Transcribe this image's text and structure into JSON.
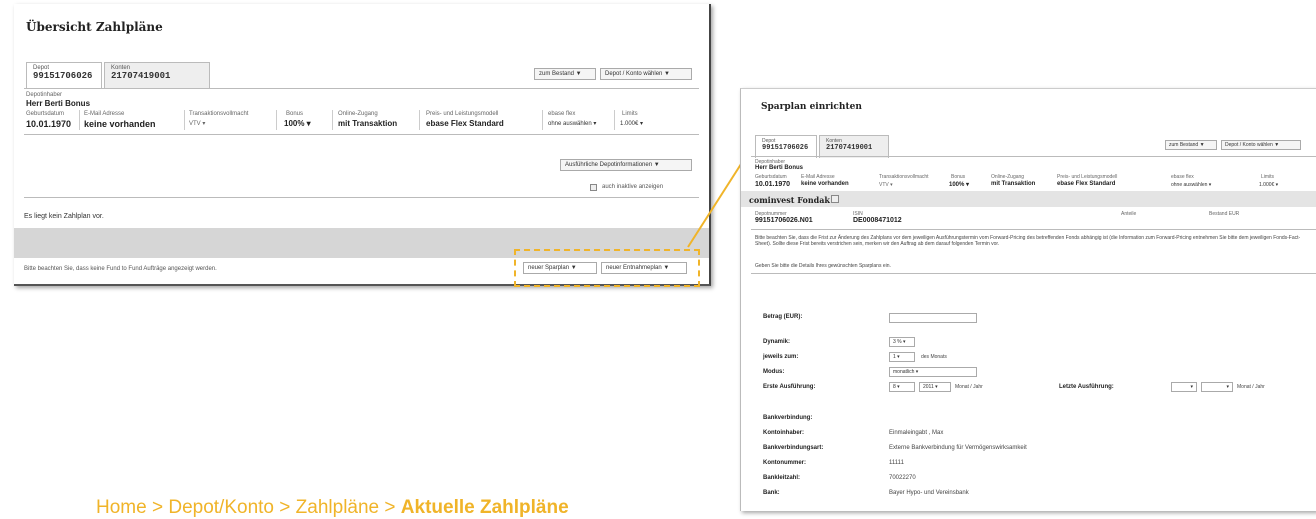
{
  "colors": {
    "accent": "#f0b429",
    "band": "#d6d6d6"
  },
  "left": {
    "title": "Übersicht Zahlpläne",
    "tabs": [
      {
        "label": "Depot",
        "value": "99151706026"
      },
      {
        "label": "Konten",
        "value": "21707419001"
      }
    ],
    "filter1": "zum Bestand ▼",
    "filter2": "Depot / Konto wählen ▼",
    "holder_label": "Depotinhaber",
    "holder_name": "Herr Berti Bonus",
    "fields": [
      {
        "label": "Geburtsdatum",
        "value": "10.01.1970"
      },
      {
        "label": "E-Mail Adresse",
        "value": "keine vorhanden"
      },
      {
        "label": "Transaktionsvollmacht",
        "value": "VTV ▾"
      },
      {
        "label": "Bonus",
        "value": "100% ▾"
      },
      {
        "label": "Online-Zugang",
        "value": "mit Transaktion"
      },
      {
        "label": "Preis- und Leistungsmodell",
        "value": "ebase Flex Standard"
      },
      {
        "label": "ebase flex",
        "value": "ohne auswählen ▾"
      },
      {
        "label": "Limits",
        "value": "1.000€ ▾"
      }
    ],
    "details_button": "Ausführliche Depotinformationen ▼",
    "inactive_label": "auch inaktive anzeigen",
    "no_plans": "Es liegt kein Zahlplan vor.",
    "btn_spar": "neuer Sparplan ▼",
    "btn_entnahme": "neuer Entnahmeplan ▼",
    "note": "Bitte beachten Sie, dass keine Fund to Fund Aufträge angezeigt werden."
  },
  "right": {
    "title": "Sparplan einrichten",
    "tabs": [
      {
        "label": "Depot",
        "value": "99151706026"
      },
      {
        "label": "Konten",
        "value": "21707419001"
      }
    ],
    "filter1": "zum Bestand ▼",
    "filter2": "Depot / Konto wählen ▼",
    "holder_label": "Depotinhaber",
    "holder_name": "Herr Berti Bonus",
    "fields": [
      {
        "label": "Geburtsdatum",
        "value": "10.01.1970"
      },
      {
        "label": "E-Mail Adresse",
        "value": "keine vorhanden"
      },
      {
        "label": "Transaktionsvollmacht",
        "value": "VTV ▾"
      },
      {
        "label": "Bonus",
        "value": "100% ▾"
      },
      {
        "label": "Online-Zugang",
        "value": "mit Transaktion"
      },
      {
        "label": "Preis- und Leistungsmodell",
        "value": "ebase Flex Standard"
      },
      {
        "label": "ebase flex",
        "value": "ohne auswählen ▾"
      },
      {
        "label": "Limits",
        "value": "1.000€ ▾"
      }
    ],
    "fund_name": "cominvest Fondak P",
    "fund_cols": [
      {
        "label": "Depotnummer",
        "value": "99151706026.N01"
      },
      {
        "label": "ISIN",
        "value": "DE0008471012"
      },
      {
        "label": "Anteile",
        "value": ""
      },
      {
        "label": "Bestand EUR",
        "value": ""
      }
    ],
    "info1": "Bitte beachten Sie, dass die Frist zur Änderung des Zahlplans vor dem jeweiligen Ausführungstermin vom Forward-Pricing des betreffenden Fonds abhängig ist (die Information zum Forward-Pricing entnehmen Sie bitte dem jeweiligen Fonds-Fact-Sheet). Sollte diese Frist bereits verstrichen sein, merken wir den Auftrag ab dem darauf folgenden Termin vor.",
    "info2": "Geben Sie bitte die Details Ihres gewünschten Sparplans ein.",
    "form": {
      "betrag_label": "Betrag (EUR):",
      "dynamik_label": "Dynamik:",
      "dynamik_value": "3 % ▾",
      "jeweils_label": "jeweils zum:",
      "jeweils_value": "1 ▾",
      "jeweils_suffix": "des Monats",
      "modus_label": "Modus:",
      "modus_value": "monatlich ▾",
      "erste_label": "Erste Ausführung:",
      "erste_month": "8 ▾",
      "erste_year": "2011 ▾",
      "erste_suffix": "Monat / Jahr",
      "letzte_label": "Letzte Ausführung:",
      "letzte_month": "▾",
      "letzte_year": "▾",
      "letzte_suffix": "Monat / Jahr"
    },
    "bank": {
      "heading": "Bankverbindung:",
      "rows": [
        {
          "label": "Kontoinhaber:",
          "value": "Einmaleingabt , Max"
        },
        {
          "label": "Bankverbindungsart:",
          "value": "Externe Bankverbindung für Vermögenswirksamkeit"
        },
        {
          "label": "Kontonummer:",
          "value": "11111"
        },
        {
          "label": "Bankleitzahl:",
          "value": "70022270"
        },
        {
          "label": "Bank:",
          "value": "Bayer Hypo- und Vereinsbank"
        }
      ]
    }
  },
  "breadcrumb": {
    "items": [
      "Home",
      "Depot/Konto",
      "Zahlpläne"
    ],
    "separator": ">",
    "current": "Aktuelle Zahlpläne"
  }
}
